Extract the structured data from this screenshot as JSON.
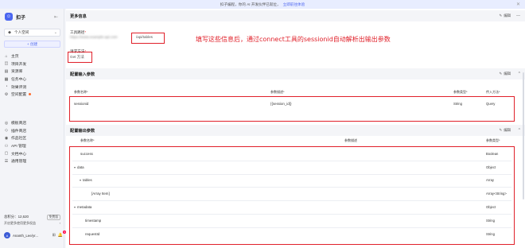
{
  "banner": {
    "text": "扣子编程，你的 AI 开发伙伴已就位，",
    "link": "立即前往体验",
    "close": "✕"
  },
  "sidebar": {
    "brand": "扣子",
    "collapse": "⇤",
    "space": "个人空间",
    "create": "+ 创建",
    "nav1": [
      {
        "icon": "⌂",
        "label": "主页"
      },
      {
        "icon": "◫",
        "label": "项目开发"
      },
      {
        "icon": "▤",
        "label": "资源库"
      },
      {
        "icon": "▦",
        "label": "任务中心"
      },
      {
        "icon": "◔",
        "label": "效果评测"
      },
      {
        "icon": "⚙",
        "label": "空间配置"
      }
    ],
    "nav2": [
      {
        "icon": "◎",
        "label": "模板商店"
      },
      {
        "icon": "◇",
        "label": "插件商店"
      },
      {
        "icon": "◉",
        "label": "作品社区"
      },
      {
        "icon": "⚇",
        "label": "API 管理"
      },
      {
        "icon": "▢",
        "label": "文档中心"
      },
      {
        "icon": "☰",
        "label": "通用管理"
      }
    ],
    "points_label": "总积分：12,620",
    "points_tag": "免费版",
    "points_sub": "开启更多使用更多权益",
    "points_chev": "›",
    "user": "Ananth_Lee/yr...",
    "user_avatar": "A",
    "msg_count": "9",
    "grid_icon": "⊞",
    "bell_icon": "🔔"
  },
  "main": {
    "more_info": {
      "title": "更多信息",
      "edit": "编辑",
      "fold": "—"
    },
    "path_label": "工具路径",
    "req": "*",
    "path_blurred": "https://www.example-api.com",
    "path_value": "/api/tables",
    "method_label": "请求方法",
    "method_value": "Get 方法",
    "annotation": "填写这些信息后，通过connect工具的sessionid自动解析出输出参数",
    "input": {
      "title": "配置输入参数",
      "edit": "编辑",
      "fold": "^",
      "headers": [
        "参数名称*",
        "参数描述*",
        "参数类型*",
        "传入方法*"
      ],
      "row": [
        "sessionid",
        "{{session_id}}",
        "String",
        "Query"
      ]
    },
    "output": {
      "title": "配置输出参数",
      "edit": "编辑",
      "fold": "^",
      "headers": [
        "参数名称*",
        "参数描述",
        "参数类型*"
      ],
      "rows": [
        {
          "name": "success",
          "type": "Boolean"
        },
        {
          "name": "data",
          "type": "Object"
        },
        {
          "name": "tables",
          "type": "Array"
        },
        {
          "name": "[Array Item]",
          "type": "Array<String>"
        },
        {
          "name": "metadata",
          "type": "Object"
        },
        {
          "name": "timestamp",
          "type": "String"
        },
        {
          "name": "requestId",
          "type": "String"
        }
      ]
    }
  }
}
